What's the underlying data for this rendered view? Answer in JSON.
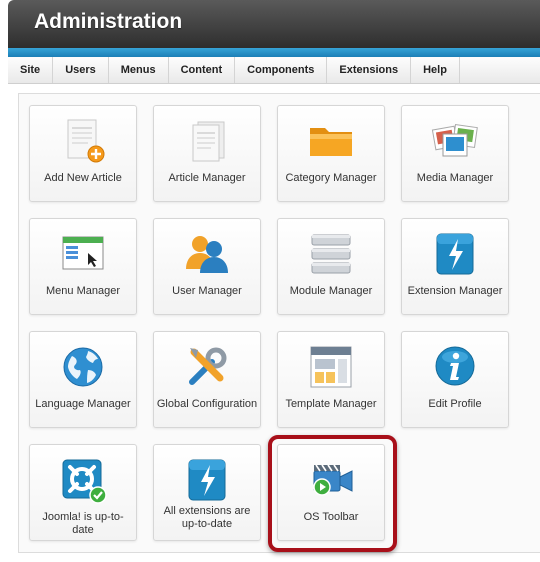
{
  "header": {
    "title": "Administration"
  },
  "menu": [
    "Site",
    "Users",
    "Menus",
    "Content",
    "Components",
    "Extensions",
    "Help"
  ],
  "tiles": [
    {
      "label": "Add New Article",
      "icon": "add-article-icon"
    },
    {
      "label": "Article Manager",
      "icon": "article-manager-icon"
    },
    {
      "label": "Category Manager",
      "icon": "folder-icon"
    },
    {
      "label": "Media Manager",
      "icon": "media-icon"
    },
    {
      "label": "Menu Manager",
      "icon": "menu-manager-icon"
    },
    {
      "label": "User Manager",
      "icon": "users-icon"
    },
    {
      "label": "Module Manager",
      "icon": "module-icon"
    },
    {
      "label": "Extension Manager",
      "icon": "extension-icon"
    },
    {
      "label": "Language Manager",
      "icon": "globe-icon"
    },
    {
      "label": "Global Configuration",
      "icon": "tools-icon"
    },
    {
      "label": "Template Manager",
      "icon": "template-icon"
    },
    {
      "label": "Edit Profile",
      "icon": "info-icon"
    },
    {
      "label": "Joomla! is up-to-date",
      "icon": "joomla-check-icon"
    },
    {
      "label": "All extensions are up-to-date",
      "icon": "extension-icon"
    },
    {
      "label": "OS Toolbar",
      "icon": "video-camera-icon"
    }
  ],
  "colors": {
    "accent_blue": "#1f8ac4",
    "highlight_red": "#a8101a",
    "folder_orange": "#f6a623"
  }
}
